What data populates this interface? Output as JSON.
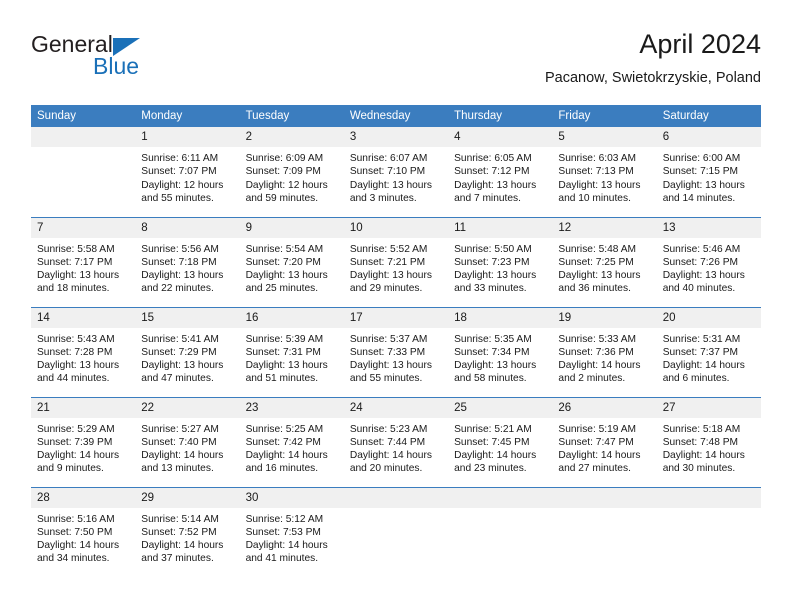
{
  "brand": {
    "name_part1": "General",
    "name_part2": "Blue",
    "triangle_color": "#1a70b8"
  },
  "header": {
    "title": "April 2024",
    "subtitle": "Pacanow, Swietokrzyskie, Poland",
    "header_bg": "#3b7dbf",
    "daynum_bg": "#f0f0f0"
  },
  "weekday_headers": [
    "Sunday",
    "Monday",
    "Tuesday",
    "Wednesday",
    "Thursday",
    "Friday",
    "Saturday"
  ],
  "weeks": [
    [
      {
        "day": "",
        "lines": []
      },
      {
        "day": "1",
        "lines": [
          "Sunrise: 6:11 AM",
          "Sunset: 7:07 PM",
          "Daylight: 12 hours",
          "and 55 minutes."
        ]
      },
      {
        "day": "2",
        "lines": [
          "Sunrise: 6:09 AM",
          "Sunset: 7:09 PM",
          "Daylight: 12 hours",
          "and 59 minutes."
        ]
      },
      {
        "day": "3",
        "lines": [
          "Sunrise: 6:07 AM",
          "Sunset: 7:10 PM",
          "Daylight: 13 hours",
          "and 3 minutes."
        ]
      },
      {
        "day": "4",
        "lines": [
          "Sunrise: 6:05 AM",
          "Sunset: 7:12 PM",
          "Daylight: 13 hours",
          "and 7 minutes."
        ]
      },
      {
        "day": "5",
        "lines": [
          "Sunrise: 6:03 AM",
          "Sunset: 7:13 PM",
          "Daylight: 13 hours",
          "and 10 minutes."
        ]
      },
      {
        "day": "6",
        "lines": [
          "Sunrise: 6:00 AM",
          "Sunset: 7:15 PM",
          "Daylight: 13 hours",
          "and 14 minutes."
        ]
      }
    ],
    [
      {
        "day": "7",
        "lines": [
          "Sunrise: 5:58 AM",
          "Sunset: 7:17 PM",
          "Daylight: 13 hours",
          "and 18 minutes."
        ]
      },
      {
        "day": "8",
        "lines": [
          "Sunrise: 5:56 AM",
          "Sunset: 7:18 PM",
          "Daylight: 13 hours",
          "and 22 minutes."
        ]
      },
      {
        "day": "9",
        "lines": [
          "Sunrise: 5:54 AM",
          "Sunset: 7:20 PM",
          "Daylight: 13 hours",
          "and 25 minutes."
        ]
      },
      {
        "day": "10",
        "lines": [
          "Sunrise: 5:52 AM",
          "Sunset: 7:21 PM",
          "Daylight: 13 hours",
          "and 29 minutes."
        ]
      },
      {
        "day": "11",
        "lines": [
          "Sunrise: 5:50 AM",
          "Sunset: 7:23 PM",
          "Daylight: 13 hours",
          "and 33 minutes."
        ]
      },
      {
        "day": "12",
        "lines": [
          "Sunrise: 5:48 AM",
          "Sunset: 7:25 PM",
          "Daylight: 13 hours",
          "and 36 minutes."
        ]
      },
      {
        "day": "13",
        "lines": [
          "Sunrise: 5:46 AM",
          "Sunset: 7:26 PM",
          "Daylight: 13 hours",
          "and 40 minutes."
        ]
      }
    ],
    [
      {
        "day": "14",
        "lines": [
          "Sunrise: 5:43 AM",
          "Sunset: 7:28 PM",
          "Daylight: 13 hours",
          "and 44 minutes."
        ]
      },
      {
        "day": "15",
        "lines": [
          "Sunrise: 5:41 AM",
          "Sunset: 7:29 PM",
          "Daylight: 13 hours",
          "and 47 minutes."
        ]
      },
      {
        "day": "16",
        "lines": [
          "Sunrise: 5:39 AM",
          "Sunset: 7:31 PM",
          "Daylight: 13 hours",
          "and 51 minutes."
        ]
      },
      {
        "day": "17",
        "lines": [
          "Sunrise: 5:37 AM",
          "Sunset: 7:33 PM",
          "Daylight: 13 hours",
          "and 55 minutes."
        ]
      },
      {
        "day": "18",
        "lines": [
          "Sunrise: 5:35 AM",
          "Sunset: 7:34 PM",
          "Daylight: 13 hours",
          "and 58 minutes."
        ]
      },
      {
        "day": "19",
        "lines": [
          "Sunrise: 5:33 AM",
          "Sunset: 7:36 PM",
          "Daylight: 14 hours",
          "and 2 minutes."
        ]
      },
      {
        "day": "20",
        "lines": [
          "Sunrise: 5:31 AM",
          "Sunset: 7:37 PM",
          "Daylight: 14 hours",
          "and 6 minutes."
        ]
      }
    ],
    [
      {
        "day": "21",
        "lines": [
          "Sunrise: 5:29 AM",
          "Sunset: 7:39 PM",
          "Daylight: 14 hours",
          "and 9 minutes."
        ]
      },
      {
        "day": "22",
        "lines": [
          "Sunrise: 5:27 AM",
          "Sunset: 7:40 PM",
          "Daylight: 14 hours",
          "and 13 minutes."
        ]
      },
      {
        "day": "23",
        "lines": [
          "Sunrise: 5:25 AM",
          "Sunset: 7:42 PM",
          "Daylight: 14 hours",
          "and 16 minutes."
        ]
      },
      {
        "day": "24",
        "lines": [
          "Sunrise: 5:23 AM",
          "Sunset: 7:44 PM",
          "Daylight: 14 hours",
          "and 20 minutes."
        ]
      },
      {
        "day": "25",
        "lines": [
          "Sunrise: 5:21 AM",
          "Sunset: 7:45 PM",
          "Daylight: 14 hours",
          "and 23 minutes."
        ]
      },
      {
        "day": "26",
        "lines": [
          "Sunrise: 5:19 AM",
          "Sunset: 7:47 PM",
          "Daylight: 14 hours",
          "and 27 minutes."
        ]
      },
      {
        "day": "27",
        "lines": [
          "Sunrise: 5:18 AM",
          "Sunset: 7:48 PM",
          "Daylight: 14 hours",
          "and 30 minutes."
        ]
      }
    ],
    [
      {
        "day": "28",
        "lines": [
          "Sunrise: 5:16 AM",
          "Sunset: 7:50 PM",
          "Daylight: 14 hours",
          "and 34 minutes."
        ]
      },
      {
        "day": "29",
        "lines": [
          "Sunrise: 5:14 AM",
          "Sunset: 7:52 PM",
          "Daylight: 14 hours",
          "and 37 minutes."
        ]
      },
      {
        "day": "30",
        "lines": [
          "Sunrise: 5:12 AM",
          "Sunset: 7:53 PM",
          "Daylight: 14 hours",
          "and 41 minutes."
        ]
      },
      {
        "day": "",
        "lines": []
      },
      {
        "day": "",
        "lines": []
      },
      {
        "day": "",
        "lines": []
      },
      {
        "day": "",
        "lines": []
      }
    ]
  ]
}
